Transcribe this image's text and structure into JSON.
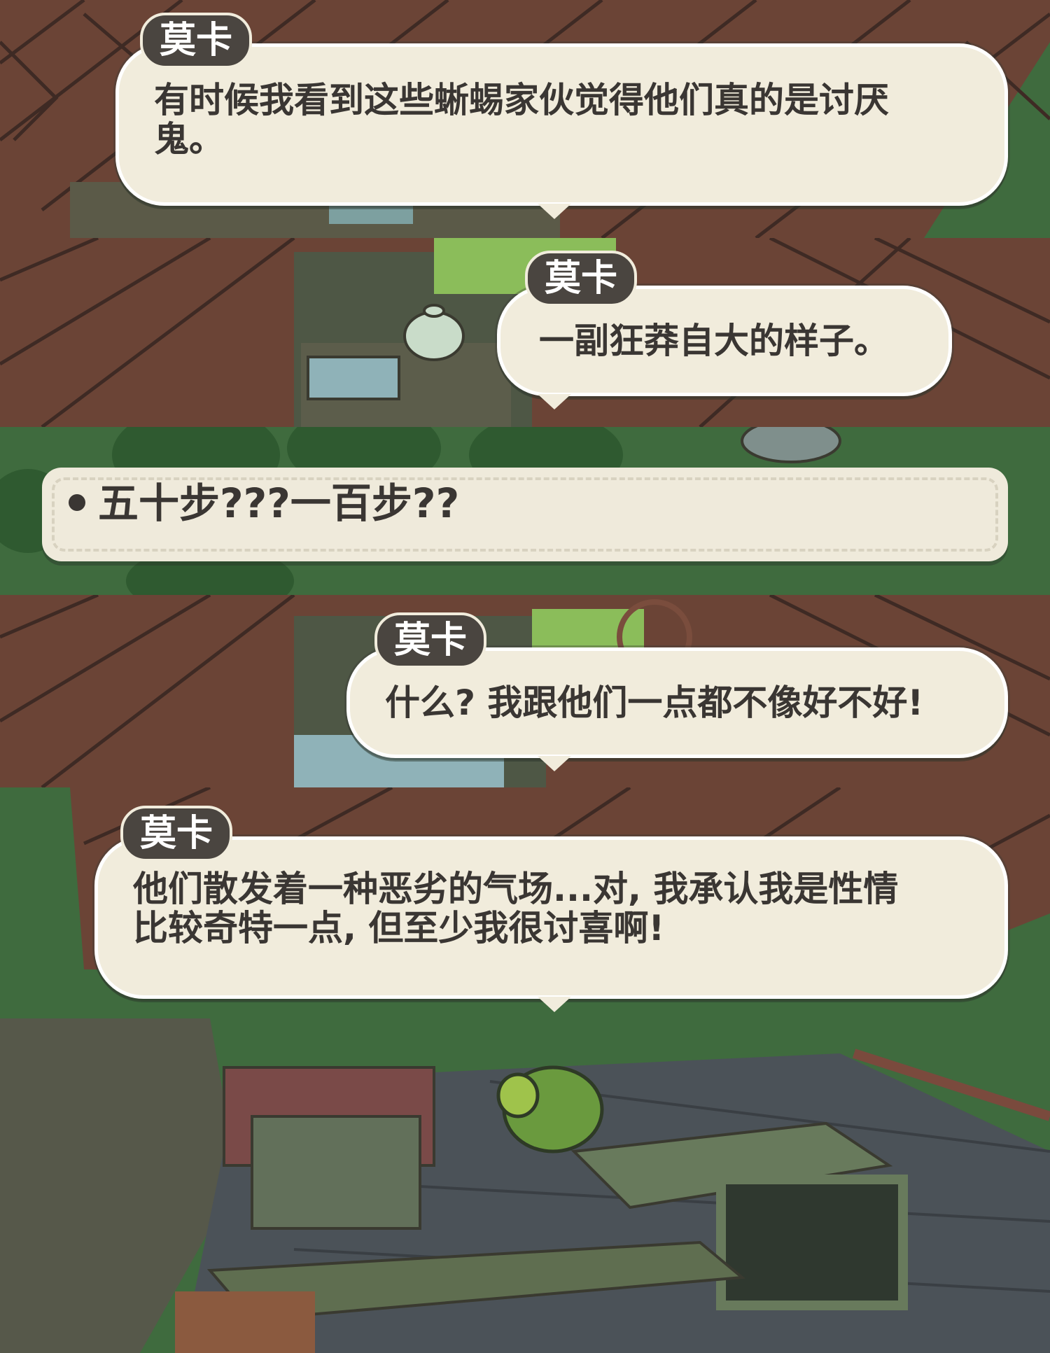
{
  "panels": [
    {
      "speaker": "莫卡",
      "line1": "有时候我看到这些蜥蜴家伙觉得他们真的是讨厌",
      "line2": "鬼。"
    },
    {
      "speaker": "莫卡",
      "line1": "一副狂莽自大的样子。"
    },
    {
      "choice": "五十步???一百步??"
    },
    {
      "speaker": "莫卡",
      "line1": "什么? 我跟他们一点都不像好不好!"
    },
    {
      "speaker": "莫卡",
      "line1": "他们散发着一种恶劣的气场...对, 我承认我是性情",
      "line2": "比较奇特一点, 但至少我很讨喜啊!"
    }
  ],
  "colors": {
    "bubble": "#f1ecdc",
    "name_tag": "#4a4540",
    "text": "#3a3633",
    "grass": "#3f6b3e",
    "roof": "#6e4a3c"
  },
  "icons": [
    "choice-bullet-icon",
    "teapot-icon",
    "turtle-icon"
  ]
}
